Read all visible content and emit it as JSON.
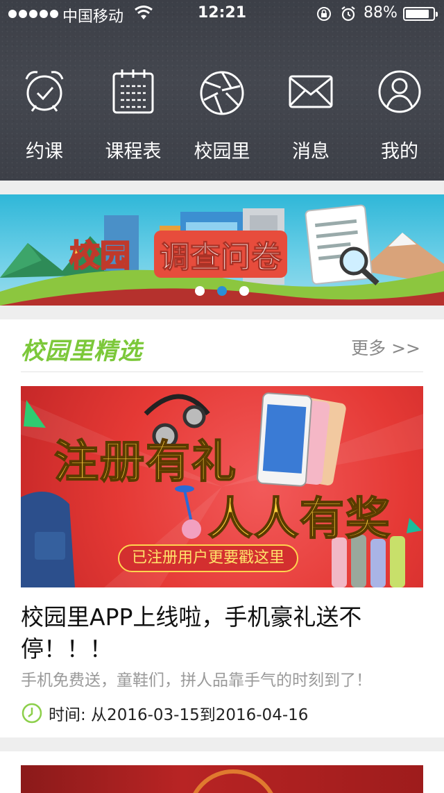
{
  "status_bar": {
    "carrier": "中国移动",
    "time": "12:21",
    "battery_percent": "88%",
    "battery_level": 0.88
  },
  "nav": {
    "items": [
      {
        "label": "约课",
        "icon": "alarm-clock-icon"
      },
      {
        "label": "课程表",
        "icon": "calendar-icon"
      },
      {
        "label": "校园里",
        "icon": "aperture-icon"
      },
      {
        "label": "消息",
        "icon": "envelope-icon"
      },
      {
        "label": "我的",
        "icon": "user-icon"
      }
    ]
  },
  "banner": {
    "text_1": "校园",
    "text_2": "调查问卷",
    "slide_count": 3,
    "active_slide": 2
  },
  "section": {
    "title": "校园里精选",
    "more_label": "更多 >>"
  },
  "promo": {
    "text_1": "注册有礼",
    "text_2": "人人有奖",
    "pill": "已注册用户更要戳这里"
  },
  "post": {
    "title": "校园里APP上线啦，手机豪礼送不停！！！",
    "subtitle": "手机免费送，童鞋们，拼人品靠手气的时刻到了！",
    "time": "时间: 从2016-03-15到2016-04-16"
  },
  "colors": {
    "header_bg": "#3f424a",
    "accent_green": "#7cc83a",
    "dot_active": "#2a8fd6"
  }
}
